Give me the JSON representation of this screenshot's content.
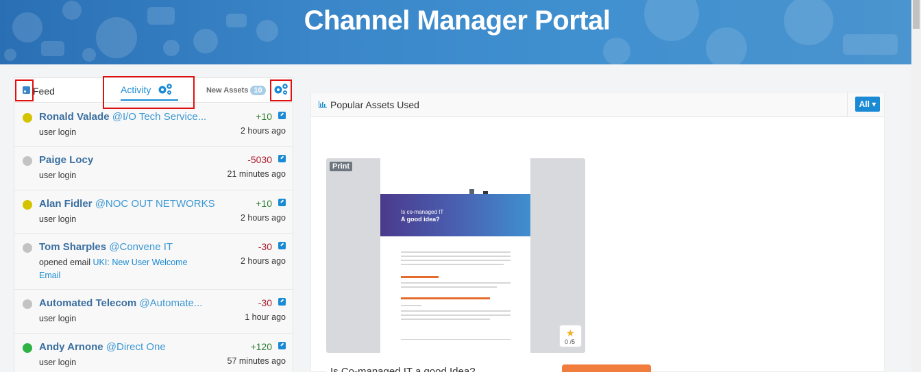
{
  "header": {
    "title": "Channel Manager Portal"
  },
  "tabs": {
    "feed_label": "Feed",
    "activity_label": "Activity",
    "new_assets_label": "New Assets",
    "new_assets_count": "10"
  },
  "feed": [
    {
      "name": "Ronald Valade",
      "company": "@I/O Tech Service...",
      "action": "user login",
      "link": "",
      "score": "+10",
      "time": "2 hours ago",
      "status_color": "#d4c400",
      "sign": "pos"
    },
    {
      "name": "Paige Locy",
      "company": "",
      "action": "user login",
      "link": "",
      "score": "-5030",
      "time": "21 minutes ago",
      "status_color": "#c3c3c3",
      "sign": "neg"
    },
    {
      "name": "Alan Fidler",
      "company": "@NOC OUT NETWORKS",
      "action": "user login",
      "link": "",
      "score": "+10",
      "time": "2 hours ago",
      "status_color": "#d4c400",
      "sign": "pos"
    },
    {
      "name": "Tom Sharples",
      "company": "@Convene IT",
      "action": "opened email ",
      "link": "UKI: New User Welcome Email",
      "score": "-30",
      "time": "2 hours ago",
      "status_color": "#c3c3c3",
      "sign": "neg"
    },
    {
      "name": "Automated Telecom",
      "company": "@Automate...",
      "action": "user login",
      "link": "",
      "score": "-30",
      "time": "1 hour ago",
      "status_color": "#c3c3c3",
      "sign": "neg"
    },
    {
      "name": "Andy Arnone",
      "company": "@Direct One",
      "action": "user login",
      "link": "",
      "score": "+120",
      "time": "57 minutes ago",
      "status_color": "#2fb344",
      "sign": "pos"
    }
  ],
  "popular": {
    "title": "Popular Assets Used",
    "filter_label": "All",
    "asset": {
      "type_label": "Print",
      "hero_line1": "Is co-managed IT",
      "hero_line2": "A good idea?",
      "rating": "0 /5",
      "title": "Is Co-managed IT a good Idea?"
    }
  },
  "colors": {
    "accent": "#1a8ad4",
    "banner": "#3a86c8",
    "highlight": "#e01010"
  }
}
